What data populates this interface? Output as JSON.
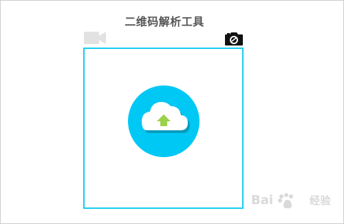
{
  "header": {
    "title": "二维码解析工具"
  },
  "toolbar": {
    "video_icon": "video-camera-icon",
    "camera_icon": "camera-icon"
  },
  "upload": {
    "icon": "cloud-upload-icon"
  },
  "watermark": {
    "logo_text": "Bai",
    "caption": "经验"
  },
  "colors": {
    "title": "#555555",
    "frame_border": "#12ccee",
    "badge": "#00c8f5",
    "arrow": "#9bd14b",
    "video_icon": "#e0e0e0",
    "camera_icon": "#111111"
  }
}
